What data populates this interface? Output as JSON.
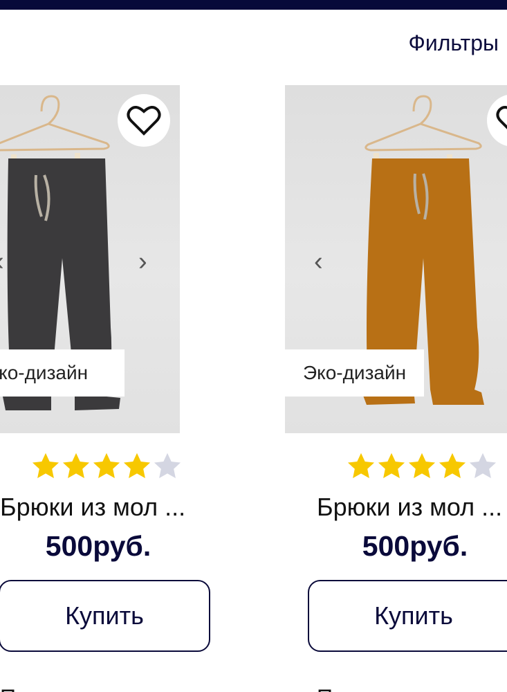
{
  "header": {
    "filters_label": "Фильтры"
  },
  "products": [
    {
      "badge": "Эко-дизайн",
      "title": "Брюки из мол ...",
      "price": "500руб.",
      "buy_label": "Купить",
      "rating": 4,
      "rating_max": 5,
      "color": "#3b3a3c",
      "next_text": "П"
    },
    {
      "badge": "Эко-дизайн",
      "title": "Брюки из мол ...",
      "price": "500руб.",
      "buy_label": "Купить",
      "rating": 4,
      "rating_max": 5,
      "color": "#b87015",
      "next_text": "П"
    }
  ],
  "colors": {
    "brand": "#070a3a",
    "star_filled": "#f7c800",
    "star_empty": "#d4d6e2"
  }
}
